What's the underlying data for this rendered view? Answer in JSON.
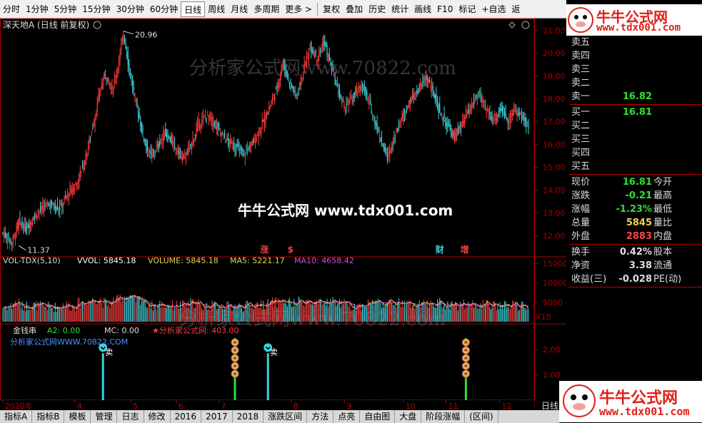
{
  "toolbar": {
    "periods": [
      "分时",
      "1分钟",
      "5分钟",
      "15分钟",
      "30分钟",
      "60分钟",
      "日线",
      "周线",
      "月线",
      "多周期",
      "更多 >"
    ],
    "tools": [
      "复权",
      "叠加",
      "历史",
      "统计",
      "画线",
      "F10",
      "标记",
      "+自选",
      "返"
    ],
    "active_period": "日线"
  },
  "main": {
    "title": "深天地A (日线 前复权)",
    "high_label": "20.96",
    "low_label": "11.37",
    "watermark": "分析家公式网www.70822.com",
    "overlay_brand": "牛牛公式网 www.tdx001.com",
    "event_markers": [
      "涨",
      "$",
      "财",
      "增"
    ]
  },
  "volume": {
    "label": "VOL-TDX(5,10)",
    "vvol": "VVOL: 5845.18",
    "volume": "VOLUME: 5845.18",
    "ma5": "MA5: 5221.17",
    "ma10": "MA10: 4658.42",
    "multiplier": "X10",
    "watermark": "分析家公式网www.70822.com"
  },
  "indicator": {
    "name": "金钱串",
    "a2": "A2: 0.00",
    "mc": "MC: 0.00",
    "star_text": "★分析家公式网: 403.00",
    "site": "分析家公式网WWW.70822.COM",
    "sell_label": "卖"
  },
  "x_axis": {
    "labels": [
      "2020年",
      "4",
      "5",
      "6",
      "7",
      "8",
      "9",
      "10",
      "11",
      "12"
    ],
    "right_label": "日线"
  },
  "bottom_tabs": [
    "指标A",
    "指标B",
    "模板",
    "管理",
    "日志",
    "修改",
    "2016",
    "2017",
    "2018",
    "涨跌区间",
    "方法",
    "点亮",
    "自由图",
    "大盘",
    "阶段涨幅",
    "(区间)"
  ],
  "brand": {
    "name": "牛牛公式网",
    "url": "www.tdx001.com"
  },
  "quote": {
    "asks": [
      {
        "label": "卖五",
        "price": ""
      },
      {
        "label": "卖四",
        "price": ""
      },
      {
        "label": "卖三",
        "price": ""
      },
      {
        "label": "卖二",
        "price": ""
      },
      {
        "label": "卖一",
        "price": "16.82"
      }
    ],
    "bids": [
      {
        "label": "买一",
        "price": "16.81"
      },
      {
        "label": "买二",
        "price": ""
      },
      {
        "label": "买三",
        "price": ""
      },
      {
        "label": "买四",
        "price": ""
      },
      {
        "label": "买五",
        "price": ""
      }
    ],
    "stats": [
      {
        "label": "现价",
        "value": "16.81",
        "label2": "今开",
        "color": "#33dd33"
      },
      {
        "label": "涨跌",
        "value": "-0.21",
        "label2": "最高",
        "color": "#33dd33"
      },
      {
        "label": "涨幅",
        "value": "-1.23%",
        "label2": "最低",
        "color": "#33dd33"
      },
      {
        "label": "总量",
        "value": "5845",
        "label2": "量比",
        "color": "#e8d44d"
      },
      {
        "label": "外盘",
        "value": "2883",
        "label2": "内盘",
        "color": "#ff4444"
      }
    ],
    "stats2": [
      {
        "label": "换手",
        "value": "0.42%",
        "label2": "股本",
        "color": "#dddddd"
      },
      {
        "label": "净资",
        "value": "3.38",
        "label2": "流通",
        "color": "#dddddd"
      },
      {
        "label": "收益(三)",
        "value": "-0.028",
        "label2": "PE(动)",
        "color": "#dddddd"
      }
    ]
  },
  "colors": {
    "up": "#ff3c3c",
    "down": "#3cd2dc",
    "axis": "#b00000",
    "vvol": "#ffffff",
    "ma5": "#e8d44d",
    "ma10": "#d050d0",
    "signal": "#33dd33",
    "sell": "#3cd2dc"
  },
  "chart_data": {
    "type": "candlestick",
    "title": "深天地A (日线 前复权)",
    "ylim": [
      11.2,
      21.2
    ],
    "y_ticks": [
      12.0,
      13.0,
      14.0,
      15.0,
      16.0,
      17.0,
      18.0,
      19.0,
      20.0,
      21.0
    ],
    "vol_ticks": [
      5000,
      10000,
      15000
    ],
    "ind_ticks": [
      1.0,
      2.0
    ],
    "x_labels": [
      "2020年",
      "4",
      "5",
      "6",
      "7",
      "8",
      "9",
      "10",
      "11",
      "12"
    ],
    "segments": [
      [
        0,
        12.1
      ],
      [
        8,
        11.7
      ],
      [
        14,
        12.6
      ],
      [
        20,
        12.3
      ],
      [
        30,
        13.0
      ],
      [
        40,
        13.4
      ],
      [
        50,
        13.2
      ],
      [
        58,
        13.9
      ],
      [
        64,
        14.2
      ],
      [
        72,
        15.3
      ],
      [
        80,
        17.0
      ],
      [
        86,
        18.5
      ],
      [
        90,
        19.1
      ],
      [
        96,
        18.4
      ],
      [
        102,
        19.7
      ],
      [
        106,
        20.9
      ],
      [
        112,
        19.0
      ],
      [
        118,
        17.6
      ],
      [
        124,
        16.2
      ],
      [
        130,
        15.5
      ],
      [
        136,
        15.9
      ],
      [
        142,
        16.5
      ],
      [
        150,
        16.0
      ],
      [
        158,
        15.4
      ],
      [
        164,
        15.8
      ],
      [
        172,
        16.9
      ],
      [
        180,
        17.3
      ],
      [
        188,
        16.8
      ],
      [
        196,
        16.2
      ],
      [
        204,
        15.9
      ],
      [
        212,
        15.6
      ],
      [
        220,
        16.1
      ],
      [
        228,
        16.9
      ],
      [
        236,
        17.8
      ],
      [
        242,
        18.7
      ],
      [
        246,
        19.6
      ],
      [
        252,
        18.7
      ],
      [
        258,
        18.1
      ],
      [
        264,
        19.2
      ],
      [
        270,
        20.3
      ],
      [
        276,
        19.8
      ],
      [
        282,
        20.5
      ],
      [
        288,
        19.5
      ],
      [
        294,
        18.4
      ],
      [
        300,
        17.6
      ],
      [
        308,
        18.1
      ],
      [
        316,
        18.6
      ],
      [
        324,
        17.5
      ],
      [
        332,
        16.2
      ],
      [
        338,
        15.4
      ],
      [
        344,
        16.3
      ],
      [
        350,
        17.1
      ],
      [
        358,
        17.9
      ],
      [
        366,
        18.4
      ],
      [
        372,
        19.0
      ],
      [
        378,
        18.3
      ],
      [
        384,
        17.4
      ],
      [
        390,
        16.9
      ],
      [
        396,
        16.3
      ],
      [
        404,
        16.9
      ],
      [
        412,
        17.7
      ],
      [
        418,
        18.2
      ],
      [
        424,
        17.6
      ],
      [
        430,
        17.1
      ],
      [
        438,
        17.5
      ],
      [
        444,
        17.1
      ],
      [
        450,
        17.5
      ],
      [
        456,
        17.2
      ],
      [
        462,
        16.81
      ]
    ],
    "events": [
      {
        "label": "涨",
        "index": 230,
        "color": "#ff3c3c"
      },
      {
        "label": "$",
        "index": 254,
        "color": "#ff3c3c"
      },
      {
        "label": "财",
        "index": 384,
        "color": "#3cd2dc"
      },
      {
        "label": "增",
        "index": 406,
        "color": "#ff3c3c"
      }
    ],
    "signals": [
      {
        "type": "sell",
        "index": 88,
        "height": 1.85
      },
      {
        "type": "coin",
        "index": 204,
        "height": 2.45
      },
      {
        "type": "sell",
        "index": 233,
        "height": 1.85
      },
      {
        "type": "coin",
        "index": 407,
        "height": 2.45
      }
    ],
    "high": {
      "value": 20.96,
      "index": 106
    },
    "low": {
      "value": 11.37,
      "index": 14
    }
  }
}
